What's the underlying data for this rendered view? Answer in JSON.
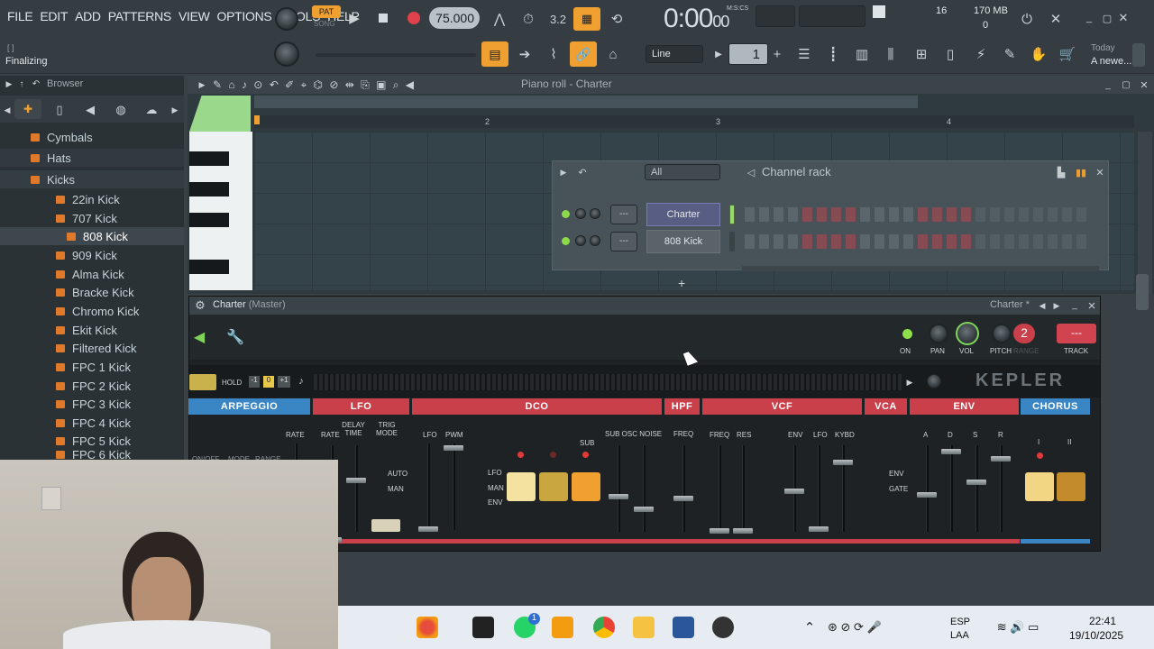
{
  "menu": [
    "FILE",
    "EDIT",
    "ADD",
    "PATTERNS",
    "VIEW",
    "OPTIONS",
    "TOOLS",
    "HELP"
  ],
  "transport": {
    "pat": "PAT",
    "song": "SONG",
    "tempo": "75.000",
    "time": "0:00",
    "time_sub": "00",
    "mscs": "M:S:CS"
  },
  "cpu": {
    "poly": "16",
    "mem": "170 MB",
    "voices": "0"
  },
  "hint": {
    "top": "[ ]",
    "status": "Finalizing"
  },
  "snap": {
    "value": "Line",
    "step": "1"
  },
  "news": {
    "title": "Today",
    "text": "A newe..."
  },
  "browser": {
    "title": "Browser",
    "items": [
      "Cymbals",
      "Hats",
      "Kicks",
      "22in Kick",
      "707 Kick",
      "808 Kick",
      "909 Kick",
      "Alma Kick",
      "Bracke Kick",
      "Chromo Kick",
      "Ekit Kick",
      "Filtered Kick",
      "FPC 1 Kick",
      "FPC 2 Kick",
      "FPC 3 Kick",
      "FPC 4 Kick",
      "FPC 5 Kick",
      "FPC 6 Kick"
    ]
  },
  "pianoroll": {
    "title": "Piano roll - Charter",
    "bars": [
      "2",
      "3",
      "4"
    ]
  },
  "channelrack": {
    "title": "Channel rack",
    "filter": "All",
    "channels": [
      {
        "name": "Charter",
        "slot": "---"
      },
      {
        "name": "808 Kick",
        "slot": "---"
      }
    ],
    "add": "+"
  },
  "plugin": {
    "title": "Charter",
    "subtitle": "(Master)",
    "preset": "Charter *",
    "close": "×",
    "brand": "KEPLER",
    "knobs": {
      "on": "ON",
      "pan": "PAN",
      "vol": "VOL",
      "pitch": "PITCH",
      "range": "RANGE",
      "track": "TRACK",
      "range_value": "2",
      "track_value": "---"
    },
    "arp": {
      "hold": "HOLD",
      "minus": "-1",
      "zero": "0",
      "plus": "+1"
    },
    "sections": [
      "ARPEGGIO",
      "LFO",
      "DCO",
      "HPF",
      "VCF",
      "VCA",
      "ENV",
      "CHORUS"
    ],
    "labels": {
      "rate": "RATE",
      "lfo_rate": "RATE",
      "delay": "DELAY TIME",
      "trig": "TRIG MODE",
      "auto": "AUTO",
      "man": "MAN",
      "lfo": "LFO",
      "pwm": "PWM",
      "dco_lfo": "LFO",
      "dco_man": "MAN",
      "dco_env": "ENV",
      "sub": "SUB",
      "suboscnoise": "SUB OSC NOISE",
      "freq": "FREQ",
      "vfreq": "FREQ",
      "res": "RES",
      "venv": "ENV",
      "vlfo": "LFO",
      "kybd": "KYBD",
      "env": "ENV",
      "gate": "GATE",
      "a": "A",
      "d": "D",
      "s": "S",
      "r": "R",
      "ch1": "I",
      "ch2": "II",
      "onoff": "ON/OFF",
      "mode": "MODE",
      "range": "RANGE"
    }
  },
  "taskbar": {
    "lang": "ESP",
    "lang2": "LAA",
    "time": "22:41",
    "date": "19/10/2025",
    "badge": "1"
  },
  "colors": {
    "orange": "#f0a030",
    "arp": "#3a86c4",
    "red": "#c9404a",
    "chorus": "#3a86c4",
    "accent_green": "#7fd35a"
  }
}
